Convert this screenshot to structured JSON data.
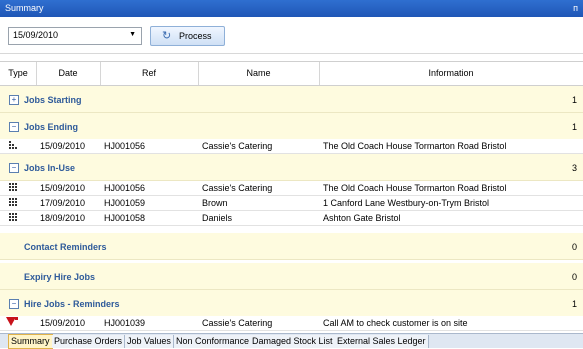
{
  "window": {
    "title": "Summary",
    "pin_glyph": "ᴨ"
  },
  "toolbar": {
    "date_value": "15/09/2010",
    "process_label": "Process"
  },
  "columns": [
    "Type",
    "Date",
    "Ref",
    "Name",
    "Information"
  ],
  "groups": {
    "jobs_starting": {
      "label": "Jobs Starting",
      "count": "1"
    },
    "jobs_ending": {
      "label": "Jobs Ending",
      "count": "1"
    },
    "jobs_in_use": {
      "label": "Jobs In-Use",
      "count": "3"
    },
    "contact_reminders": {
      "label": "Contact Reminders",
      "count": "0"
    },
    "expiry_hire_jobs": {
      "label": "Expiry Hire Jobs",
      "count": "0"
    },
    "hire_jobs_reminders": {
      "label": "Hire Jobs - Reminders",
      "count": "1"
    }
  },
  "rows": {
    "ending": [
      {
        "date": "15/09/2010",
        "ref": "HJ001056",
        "name": "Cassie's Catering",
        "info": "The Old Coach House  Tormarton Road  Bristol"
      }
    ],
    "in_use": [
      {
        "date": "15/09/2010",
        "ref": "HJ001056",
        "name": "Cassie's Catering",
        "info": "The Old Coach House  Tormarton Road  Bristol"
      },
      {
        "date": "17/09/2010",
        "ref": "HJ001059",
        "name": "Brown",
        "info": "1 Canford Lane  Westbury-on-Trym  Bristol"
      },
      {
        "date": "18/09/2010",
        "ref": "HJ001058",
        "name": "Daniels",
        "info": "Ashton Gate  Bristol"
      }
    ],
    "reminders": [
      {
        "date": "15/09/2010",
        "ref": "HJ001039",
        "name": "Cassie's Catering",
        "info": "Call AM to check customer is on site"
      }
    ]
  },
  "tabs": [
    "Summary",
    "Purchase Orders",
    "Job Values",
    "Non Conformance",
    "Damaged Stock List",
    "External Sales Ledger"
  ],
  "icons": {
    "expand": "⊞",
    "collapse": "⊟",
    "process": "↻",
    "dropdown": "▼"
  }
}
